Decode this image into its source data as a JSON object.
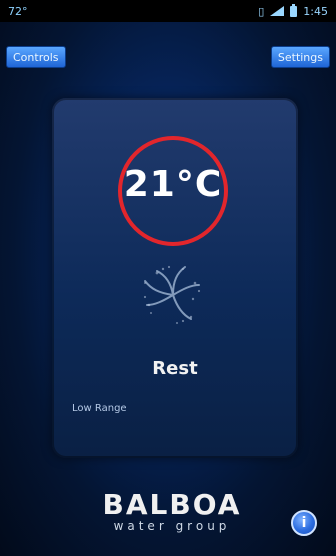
{
  "status_bar": {
    "left_text": "72°",
    "time": "1:45"
  },
  "header": {
    "left_button": "Controls",
    "right_button": "Settings"
  },
  "main": {
    "temperature": "21°C",
    "mode": "Rest",
    "range": "Low Range"
  },
  "branding": {
    "brand": "BALBOA",
    "subtitle": "water group"
  },
  "icons": {
    "fan": "fan-icon",
    "info": "info-icon",
    "signal": "signal-icon",
    "battery": "battery-icon",
    "phone": "phone-icon"
  },
  "colors": {
    "accent": "#2c6de0",
    "ring": "#e2262c"
  }
}
